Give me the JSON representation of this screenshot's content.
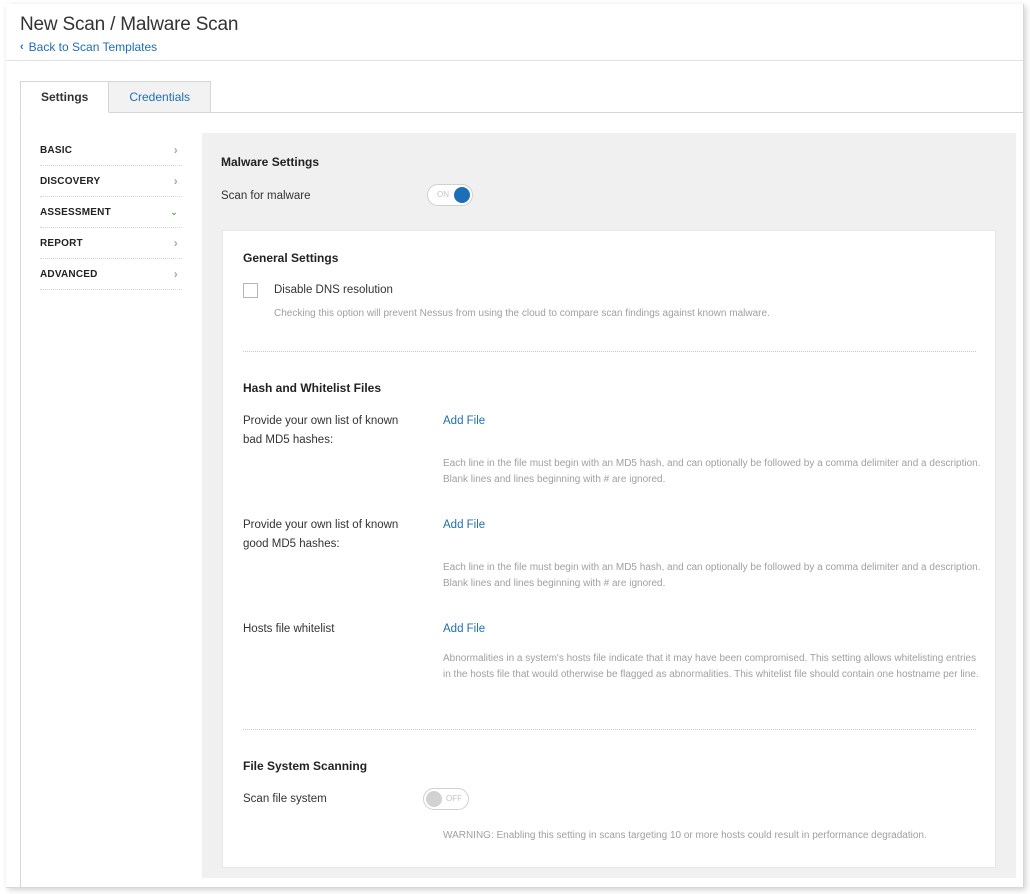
{
  "header": {
    "title": "New Scan / Malware Scan",
    "back_label": "Back to Scan Templates"
  },
  "tabs": [
    {
      "label": "Settings",
      "active": true
    },
    {
      "label": "Credentials",
      "active": false
    }
  ],
  "sidebar": {
    "items": [
      {
        "label": "BASIC",
        "icon": "chevron-right-icon"
      },
      {
        "label": "DISCOVERY",
        "icon": "chevron-right-icon"
      },
      {
        "label": "ASSESSMENT",
        "icon": "chevron-down-icon",
        "expanded": true
      },
      {
        "label": "REPORT",
        "icon": "chevron-right-icon"
      },
      {
        "label": "ADVANCED",
        "icon": "chevron-right-icon"
      }
    ]
  },
  "malware": {
    "title": "Malware Settings",
    "scan_label": "Scan for malware",
    "scan_toggle": "ON",
    "scan_enabled": true
  },
  "general": {
    "title": "General Settings",
    "dns_label": "Disable DNS resolution",
    "dns_checked": false,
    "dns_help": "Checking this option will prevent Nessus from using the cloud to compare scan findings against known malware."
  },
  "hash": {
    "title": "Hash and Whitelist Files",
    "bad": {
      "label": "Provide your own list of known bad MD5 hashes:",
      "link": "Add File",
      "help": "Each line in the file must begin with an MD5 hash, and can optionally be followed by a comma delimiter and a description. Blank lines and lines beginning with # are ignored."
    },
    "good": {
      "label": "Provide your own list of known good MD5 hashes:",
      "link": "Add File",
      "help": "Each line in the file must begin with an MD5 hash, and can optionally be followed by a comma delimiter and a description. Blank lines and lines beginning with # are ignored."
    },
    "hosts": {
      "label": "Hosts file whitelist",
      "link": "Add File",
      "help": "Abnormalities in a system's hosts file indicate that it may have been compromised. This setting allows whitelisting entries in the hosts file that would otherwise be flagged as abnormalities. This whitelist file should contain one hostname per line."
    }
  },
  "filesystem": {
    "title": "File System Scanning",
    "scan_label": "Scan file system",
    "scan_toggle": "OFF",
    "scan_enabled": false,
    "warning": "WARNING: Enabling this setting in scans targeting 10 or more hosts could result in performance degradation."
  },
  "colors": {
    "accent": "#1c6eb7",
    "expanded_chevron": "#5aa03a",
    "panel_bg": "#f0f0f0"
  }
}
